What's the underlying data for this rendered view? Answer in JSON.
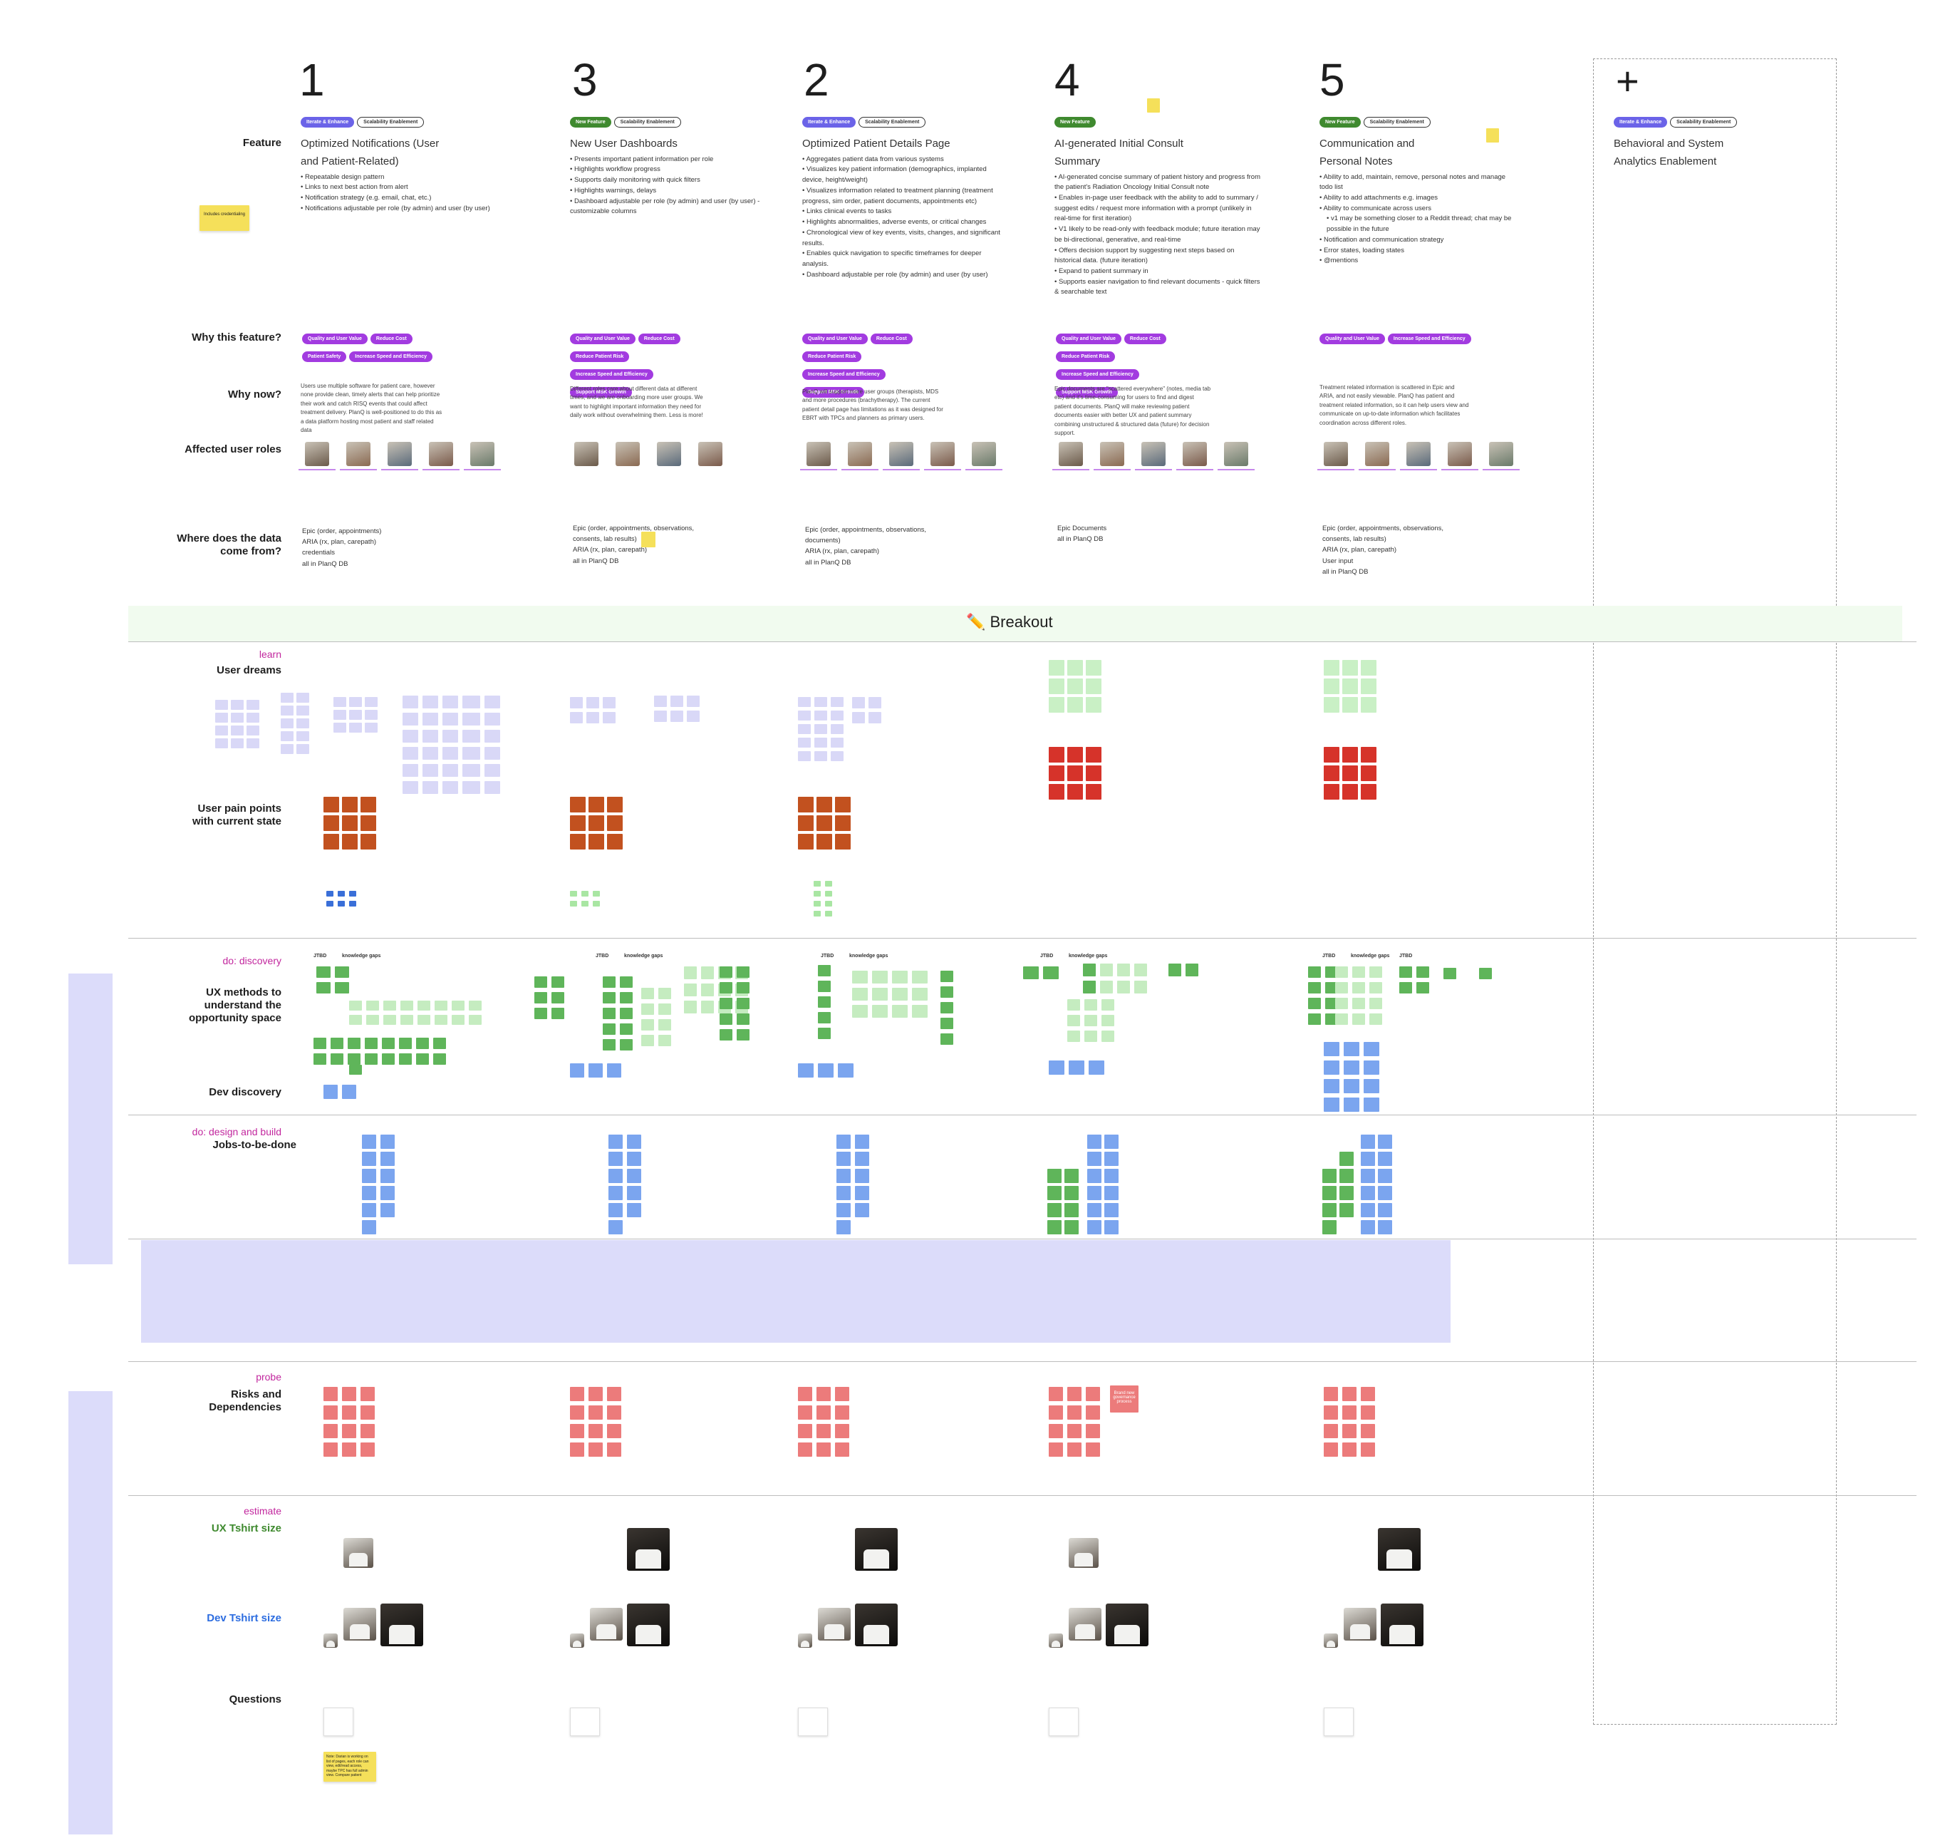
{
  "columns": [
    {
      "num": "1",
      "tags": [
        {
          "label": "Iterate & Enhance",
          "kind": "blue"
        },
        {
          "label": "Scalability Enablement",
          "kind": "outline"
        }
      ],
      "title": "Optimized Notifications (User and Patient-Related)",
      "bullets": [
        "Repeatable design pattern",
        "Links to next best action from alert",
        "Notification strategy (e.g. email, chat, etc.)",
        "Notifications adjustable per role (by admin) and user (by user)"
      ],
      "why": [
        "Quality and User Value",
        "Reduce Cost",
        "Patient Safety",
        "Increase Speed and Efficiency"
      ],
      "why_now": "Users use multiple software for patient care, however none provide clean, timely alerts that can help prioritize their work and catch RISQ events that could affect treatment delivery. PlanQ is well-positioned to do this as a data platform hosting most patient and staff related data",
      "sources": [
        "Epic (order, appointments)",
        "ARIA (rx, plan, carepath)",
        "credentials"
      ],
      "sources_foot": "all in PlanQ DB"
    },
    {
      "num": "3",
      "tags": [
        {
          "label": "New Feature",
          "kind": "green"
        },
        {
          "label": "Scalability Enablement",
          "kind": "outline"
        }
      ],
      "title": "New User Dashboards",
      "bullets": [
        "Presents important patient information per role",
        "Highlights workflow progress",
        "Supports daily monitoring with quick filters",
        "Highlights warnings, delays",
        "Dashboard adjustable per role (by admin) and user (by user) - customizable columns"
      ],
      "why": [
        "Quality and User Value",
        "Reduce Cost",
        "Reduce Patient Risk",
        "Increase Speed and Efficiency",
        "Support MSK Growth"
      ],
      "why_now": "Different roles care about different data at different times, and we are onboarding more user groups. We want to highlight important information they need for daily work without overwhelming them. Less is more!",
      "sources": [
        "Epic (order, appointments, observations, consents, lab results)",
        "ARIA (rx, plan, carepath)"
      ],
      "sources_foot": "all in PlanQ DB"
    },
    {
      "num": "2",
      "tags": [
        {
          "label": "Iterate & Enhance",
          "kind": "blue"
        },
        {
          "label": "Scalability Enablement",
          "kind": "outline"
        }
      ],
      "title": "Optimized Patient Details Page",
      "bullets": [
        "Aggregates patient data from various systems",
        "Visualizes key patient information (demographics, implanted device, height/weight)",
        "Visualizes information related to treatment planning (treatment progress, sim order, patient documents, appointments etc)",
        "Links clinical events to tasks",
        "Highlights abnormalities, adverse events, or critical changes",
        "Chronological view of key events, visits, changes, and significant results.",
        "Enables quick navigation to specific timeframes for deeper analysis.",
        "Dashboard adjustable per role (by admin) and user (by user)"
      ],
      "why": [
        "Quality and User Value",
        "Reduce Cost",
        "Reduce Patient Risk",
        "Increase Speed and Efficiency",
        "Support MSK Growth"
      ],
      "why_now": "PlanQ will support more user groups (therapists, MDS and more procedures (brachytherapy). The current patient detail page has limitations as it was designed for EBRT with TPCs and planners as primary users.",
      "sources": [
        "Epic (order, appointments, observations, documents)",
        "ARIA (rx, plan, carepath)"
      ],
      "sources_foot": "all in PlanQ DB"
    },
    {
      "num": "4",
      "tags": [
        {
          "label": "New Feature",
          "kind": "green"
        }
      ],
      "title": "AI-generated Initial Consult Summary",
      "bullets": [
        "AI-generated concise summary of patient history and progress from the patient's Radiation Oncology Initial Consult note",
        "Enables in-page user feedback with the ability to add to summary / suggest edits / request more information with a prompt (unlikely in real-time for first iteration)",
        "V1 likely to be read-only with feedback module; future iteration may be bi-directional, generative, and real-time",
        "Offers decision support by suggesting next steps based on historical data. (future iteration)",
        "Expand to patient summary in",
        "Supports easier navigation to find relevant documents - quick filters & searchable text"
      ],
      "why": [
        "Quality and User Value",
        "Reduce Cost",
        "Reduce Patient Risk",
        "Increase Speed and Efficiency",
        "Support MSK Growth"
      ],
      "why_now": "Epic documents are \"scattered everywhere\" (notes, media tab etc) and it's time-consuming for users to find and digest patient documents. PlanQ will make reviewing patient documents easier with better UX and patient summary combining unstructured & structured data (future) for decision support.",
      "sources": [],
      "sources_plain": [
        "Epic Documents"
      ],
      "sources_foot": "all in PlanQ DB"
    },
    {
      "num": "5",
      "tags": [
        {
          "label": "New Feature",
          "kind": "green"
        },
        {
          "label": "Scalability Enablement",
          "kind": "outline"
        }
      ],
      "title": "Communication and Personal Notes",
      "bullets": [
        "Ability to add, maintain, remove, personal notes and manage todo list",
        "Ability to add attachments e.g. images",
        "Ability to communicate across users",
        "v1 may be something closer to a Reddit thread; chat may be possible in the future",
        "Notification and communication strategy",
        "Error states, loading states",
        "@mentions"
      ],
      "why": [
        "Quality and User Value",
        "Increase Speed and Efficiency"
      ],
      "why_now": "Treatment related information is scattered in Epic and ARIA, and not easily viewable. PlanQ has patient and treatment related information, so it can help users view and communicate on up-to-date information which facilitates coordination across different roles.",
      "sources": [
        "Epic (order, appointments, observations, consents, lab results)",
        "ARIA (rx, plan, carepath)",
        "User input"
      ],
      "sources_foot": "all in PlanQ DB"
    }
  ],
  "plus_column": {
    "symbol": "+",
    "tags": [
      {
        "label": "Iterate & Enhance",
        "kind": "blue"
      },
      {
        "label": "Scalability Enablement",
        "kind": "outline"
      }
    ],
    "title": "Behavioral and System Analytics Enablement"
  },
  "rows": {
    "feature": "Feature",
    "why_feature": "Why this feature?",
    "why_now": "Why now?",
    "roles": "Affected user roles",
    "data_source": "Where does the data come from?",
    "user_dreams": "User dreams",
    "pain_points": "User pain points with current state",
    "ux_methods": "UX methods to understand the opportunity space",
    "dev_discovery": "Dev discovery",
    "jtbd": "Jobs-to-be-done",
    "risks": "Risks and Dependencies",
    "ux_tshirt": "UX Tshirt size",
    "dev_tshirt": "Dev Tshirt size",
    "questions": "Questions"
  },
  "phases": {
    "learn": "learn",
    "discovery": "do: discovery",
    "design": "do: design and build",
    "probe": "probe",
    "estimate": "estimate"
  },
  "breakout": {
    "icon": "pencil-icon",
    "label": "✏️ Breakout"
  },
  "sticky_left": "Includes credentialing",
  "sticky_bottom": "Note: Darian is working on list of pages, each role can view, edit/read access, maybe TPC has full admin view. Compare patient",
  "risk_note": "Brand new governance process",
  "jtbd_label": "JTBD",
  "knowledge_gaps": "knowledge gaps",
  "colors": {
    "tag_blue": "#6b63e8",
    "tag_green": "#3f8a2f",
    "why_purple": "#a23be0",
    "sticky_yellow": "#f5e05a",
    "pain_orange": "#c2511f",
    "dream_green": "#c9f0c5",
    "dream_red": "#d6332a",
    "discovery_green": "#5fb55a",
    "dev_blue": "#7ba5ef",
    "risk_pink": "#ec7b7b",
    "breakout_bg": "#f1fbef",
    "band_lavender": "#dcdcfa"
  }
}
